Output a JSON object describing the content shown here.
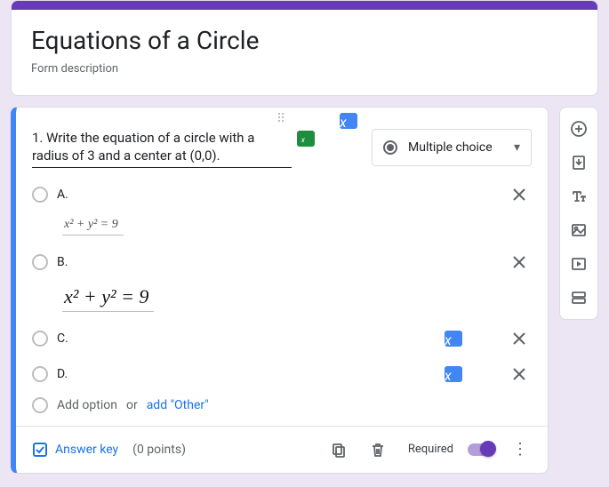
{
  "header": {
    "title": "Equations of a Circle",
    "description": "Form description"
  },
  "question": {
    "text": "1. Write the equation of a circle with a radius of 3 and a center at (0,0).",
    "type_label": "Multiple choice",
    "options": [
      {
        "label": "A.",
        "equation": "x² + y² = 9",
        "eq_style": "small",
        "has_badge": false
      },
      {
        "label": "B.",
        "equation": "x² + y²  = 9",
        "eq_style": "big",
        "has_badge": false
      },
      {
        "label": "C.",
        "equation": "",
        "eq_style": "",
        "has_badge": true
      },
      {
        "label": "D.",
        "equation": "",
        "eq_style": "",
        "has_badge": true
      }
    ],
    "add_option": "Add option",
    "or": "or",
    "add_other": "add \"Other\""
  },
  "footer": {
    "answer_key": "Answer key",
    "points": "(0 points)",
    "required": "Required"
  }
}
